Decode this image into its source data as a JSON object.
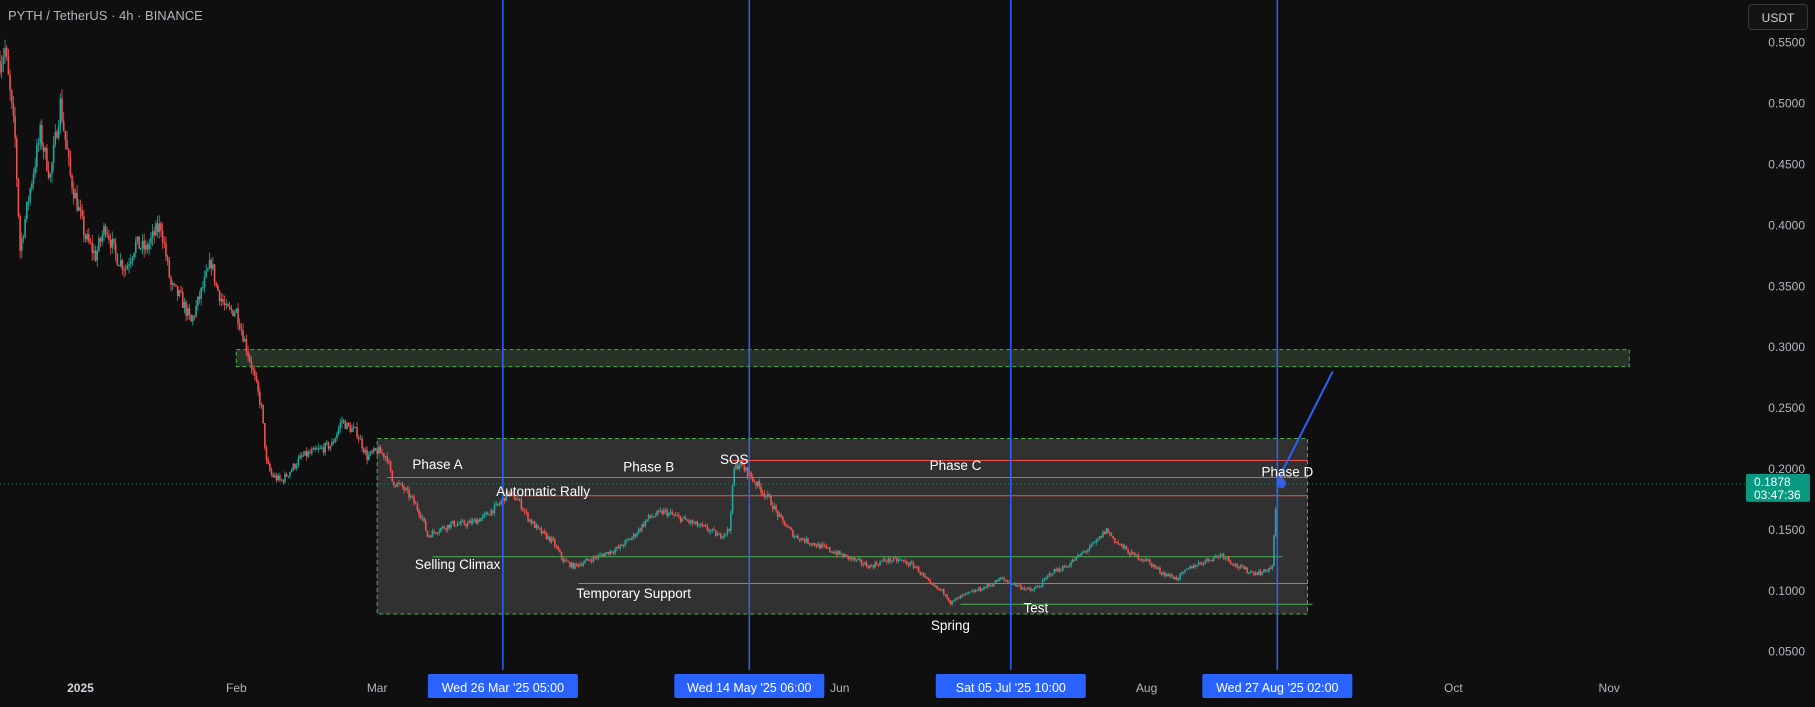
{
  "header": {
    "symbol_title": "PYTH / TetherUS · 4h · BINANCE",
    "currency_button": "USDT"
  },
  "colors": {
    "background": "#0f0f0f",
    "up_candle": "#26a69a",
    "down_candle": "#ef5350",
    "vertical_line": "#2962ff",
    "date_badge": "#2962ff",
    "price_badge": "#089981",
    "range_box_fill": "#3a3a3a",
    "zone_border": "#4caf50"
  },
  "price_badge": {
    "price": "0.1878",
    "countdown": "03:47:36"
  },
  "chart_data": {
    "type": "candlestick",
    "title": "PYTH / TetherUS · 4h · BINANCE",
    "y_axis": {
      "ticks": [
        0.55,
        0.5,
        0.45,
        0.4,
        0.35,
        0.3,
        0.25,
        0.2,
        0.15,
        0.1,
        0.05
      ],
      "tick_labels": [
        "0.5500",
        "0.5000",
        "0.4500",
        "0.4000",
        "0.3500",
        "0.3000",
        "0.2500",
        "0.2000",
        "0.1500",
        "0.1000",
        "0.0500"
      ],
      "range": [
        0.035,
        0.585
      ]
    },
    "x_axis": {
      "labels": [
        {
          "text": "2025",
          "date": "2025-01-01",
          "bold": true
        },
        {
          "text": "Feb",
          "date": "2025-02-01"
        },
        {
          "text": "Mar",
          "date": "2025-03-01"
        },
        {
          "text": "Jun",
          "date": "2025-06-01"
        },
        {
          "text": "Aug",
          "date": "2025-08-01"
        },
        {
          "text": "Oct",
          "date": "2025-10-01"
        },
        {
          "text": "Nov",
          "date": "2025-11-01"
        }
      ],
      "range": [
        "2024-12-16",
        "2025-11-28"
      ]
    },
    "current_price": 0.1878,
    "price_path": [
      [
        "2024-12-16",
        0.535
      ],
      [
        "2024-12-17",
        0.545
      ],
      [
        "2024-12-19",
        0.47
      ],
      [
        "2024-12-20",
        0.38
      ],
      [
        "2024-12-22",
        0.43
      ],
      [
        "2024-12-24",
        0.475
      ],
      [
        "2024-12-26",
        0.44
      ],
      [
        "2024-12-27",
        0.47
      ],
      [
        "2024-12-28",
        0.5
      ],
      [
        "2024-12-30",
        0.44
      ],
      [
        "2025-01-02",
        0.39
      ],
      [
        "2025-01-04",
        0.375
      ],
      [
        "2025-01-06",
        0.4
      ],
      [
        "2025-01-08",
        0.375
      ],
      [
        "2025-01-10",
        0.365
      ],
      [
        "2025-01-12",
        0.385
      ],
      [
        "2025-01-14",
        0.38
      ],
      [
        "2025-01-16",
        0.395
      ],
      [
        "2025-01-17",
        0.4
      ],
      [
        "2025-01-19",
        0.35
      ],
      [
        "2025-01-21",
        0.34
      ],
      [
        "2025-01-23",
        0.32
      ],
      [
        "2025-01-25",
        0.345
      ],
      [
        "2025-01-27",
        0.37
      ],
      [
        "2025-01-28",
        0.35
      ],
      [
        "2025-01-30",
        0.33
      ],
      [
        "2025-02-01",
        0.33
      ],
      [
        "2025-02-03",
        0.3
      ],
      [
        "2025-02-04",
        0.285
      ],
      [
        "2025-02-06",
        0.25
      ],
      [
        "2025-02-07",
        0.205
      ],
      [
        "2025-02-08",
        0.195
      ],
      [
        "2025-02-10",
        0.19
      ],
      [
        "2025-02-12",
        0.2
      ],
      [
        "2025-02-14",
        0.21
      ],
      [
        "2025-02-17",
        0.215
      ],
      [
        "2025-02-20",
        0.22
      ],
      [
        "2025-02-22",
        0.24
      ],
      [
        "2025-02-23",
        0.235
      ],
      [
        "2025-02-25",
        0.23
      ],
      [
        "2025-02-27",
        0.21
      ],
      [
        "2025-03-01",
        0.215
      ],
      [
        "2025-03-03",
        0.21
      ],
      [
        "2025-03-04",
        0.19
      ],
      [
        "2025-03-06",
        0.185
      ],
      [
        "2025-03-08",
        0.175
      ],
      [
        "2025-03-10",
        0.16
      ],
      [
        "2025-03-11",
        0.145
      ],
      [
        "2025-03-13",
        0.15
      ],
      [
        "2025-03-16",
        0.155
      ],
      [
        "2025-03-19",
        0.155
      ],
      [
        "2025-03-22",
        0.16
      ],
      [
        "2025-03-25",
        0.17
      ],
      [
        "2025-03-27",
        0.18
      ],
      [
        "2025-03-29",
        0.175
      ],
      [
        "2025-03-31",
        0.16
      ],
      [
        "2025-04-02",
        0.15
      ],
      [
        "2025-04-05",
        0.14
      ],
      [
        "2025-04-07",
        0.125
      ],
      [
        "2025-04-09",
        0.12
      ],
      [
        "2025-04-12",
        0.125
      ],
      [
        "2025-04-15",
        0.13
      ],
      [
        "2025-04-18",
        0.135
      ],
      [
        "2025-04-21",
        0.145
      ],
      [
        "2025-04-24",
        0.16
      ],
      [
        "2025-04-27",
        0.165
      ],
      [
        "2025-04-30",
        0.16
      ],
      [
        "2025-05-03",
        0.155
      ],
      [
        "2025-05-06",
        0.15
      ],
      [
        "2025-05-08",
        0.145
      ],
      [
        "2025-05-10",
        0.15
      ],
      [
        "2025-05-11",
        0.2
      ],
      [
        "2025-05-12",
        0.205
      ],
      [
        "2025-05-14",
        0.195
      ],
      [
        "2025-05-16",
        0.185
      ],
      [
        "2025-05-18",
        0.175
      ],
      [
        "2025-05-20",
        0.16
      ],
      [
        "2025-05-23",
        0.145
      ],
      [
        "2025-05-26",
        0.14
      ],
      [
        "2025-05-29",
        0.135
      ],
      [
        "2025-06-01",
        0.13
      ],
      [
        "2025-06-04",
        0.125
      ],
      [
        "2025-06-07",
        0.12
      ],
      [
        "2025-06-10",
        0.125
      ],
      [
        "2025-06-13",
        0.125
      ],
      [
        "2025-06-16",
        0.12
      ],
      [
        "2025-06-19",
        0.105
      ],
      [
        "2025-06-22",
        0.098
      ],
      [
        "2025-06-23",
        0.09
      ],
      [
        "2025-06-25",
        0.095
      ],
      [
        "2025-06-28",
        0.1
      ],
      [
        "2025-07-01",
        0.105
      ],
      [
        "2025-07-03",
        0.11
      ],
      [
        "2025-07-06",
        0.105
      ],
      [
        "2025-07-09",
        0.1
      ],
      [
        "2025-07-11",
        0.105
      ],
      [
        "2025-07-13",
        0.115
      ],
      [
        "2025-07-16",
        0.12
      ],
      [
        "2025-07-19",
        0.13
      ],
      [
        "2025-07-22",
        0.14
      ],
      [
        "2025-07-24",
        0.15
      ],
      [
        "2025-07-26",
        0.14
      ],
      [
        "2025-07-29",
        0.13
      ],
      [
        "2025-08-01",
        0.125
      ],
      [
        "2025-08-04",
        0.115
      ],
      [
        "2025-08-07",
        0.11
      ],
      [
        "2025-08-10",
        0.12
      ],
      [
        "2025-08-13",
        0.125
      ],
      [
        "2025-08-16",
        0.13
      ],
      [
        "2025-08-19",
        0.12
      ],
      [
        "2025-08-22",
        0.115
      ],
      [
        "2025-08-24",
        0.115
      ],
      [
        "2025-08-26",
        0.12
      ],
      [
        "2025-08-27",
        0.19
      ],
      [
        "2025-08-28",
        0.1878
      ]
    ],
    "vertical_markers": [
      {
        "date": "2025-03-26",
        "label": "Wed 26 Mar '25   05:00"
      },
      {
        "date": "2025-05-14",
        "label": "Wed 14 May '25   06:00"
      },
      {
        "date": "2025-07-05",
        "label": "Sat 05 Jul '25   10:00"
      },
      {
        "date": "2025-08-27",
        "label": "Wed 27 Aug '25   02:00"
      }
    ],
    "zones": [
      {
        "name": "resistance-zone",
        "from": "2025-02-01",
        "to": "2025-11-05",
        "low": 0.284,
        "high": 0.298
      },
      {
        "name": "accumulation-range",
        "from": "2025-03-01",
        "to": "2025-09-02",
        "low": 0.081,
        "high": 0.225
      }
    ],
    "levels": [
      {
        "from": "2025-03-03",
        "to": "2025-09-02",
        "price": 0.193,
        "color": "#ef5350"
      },
      {
        "from": "2025-03-26",
        "to": "2025-09-02",
        "price": 0.178,
        "color": "#ef5350"
      },
      {
        "from": "2025-05-10",
        "to": "2025-09-02",
        "price": 0.207,
        "color": "#ef5350"
      },
      {
        "from": "2025-03-12",
        "to": "2025-08-28",
        "price": 0.128,
        "color": "#4caf50"
      },
      {
        "from": "2025-04-10",
        "to": "2025-09-02",
        "price": 0.106,
        "color": "#4caf50"
      },
      {
        "from": "2025-06-25",
        "to": "2025-09-03",
        "price": 0.089,
        "color": "#4caf50"
      }
    ],
    "projection": {
      "from": [
        "2025-08-27",
        0.19
      ],
      "to": [
        "2025-09-07",
        0.28
      ]
    },
    "annotations": [
      {
        "text": "Phase A",
        "date": "2025-03-13",
        "price": 0.2
      },
      {
        "text": "Automatic Rally",
        "date": "2025-04-03",
        "price": 0.178
      },
      {
        "text": "Phase B",
        "date": "2025-04-24",
        "price": 0.198
      },
      {
        "text": "SOS",
        "date": "2025-05-11",
        "price": 0.204
      },
      {
        "text": "Phase C",
        "date": "2025-06-24",
        "price": 0.199
      },
      {
        "text": "Phase D",
        "date": "2025-08-29",
        "price": 0.194
      },
      {
        "text": "Selling Climax",
        "date": "2025-03-17",
        "price": 0.118
      },
      {
        "text": "Temporary Support",
        "date": "2025-04-21",
        "price": 0.094
      },
      {
        "text": "Test",
        "date": "2025-07-10",
        "price": 0.082
      },
      {
        "text": "Spring",
        "date": "2025-06-23",
        "price": 0.068
      }
    ]
  }
}
